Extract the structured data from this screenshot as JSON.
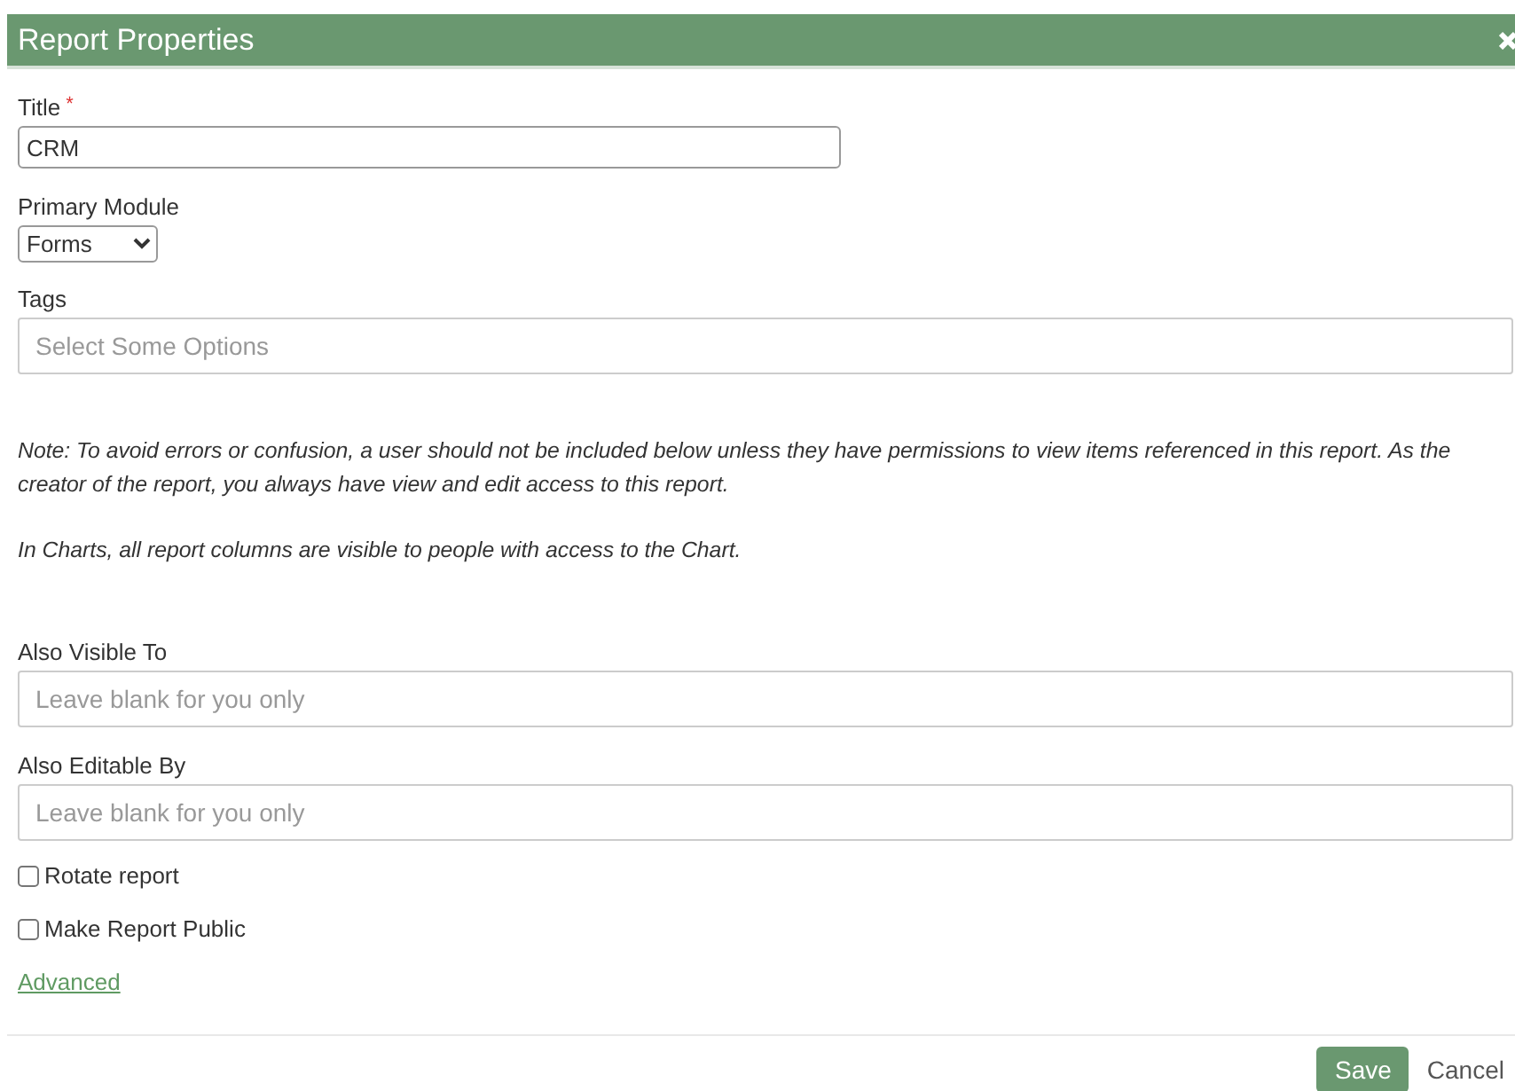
{
  "dialog": {
    "title": "Report Properties"
  },
  "title_field": {
    "label": "Title",
    "required_mark": "*",
    "value": "CRM"
  },
  "primary_module": {
    "label": "Primary Module",
    "value": "Forms"
  },
  "tags": {
    "label": "Tags",
    "placeholder": "Select Some Options"
  },
  "notes": [
    "Note: To avoid errors or confusion, a user should not be included below unless they have permissions to view items referenced in this report. As the creator of the report, you always have view and edit access to this report.",
    "In Charts, all report columns are visible to people with access to the Chart."
  ],
  "also_visible_to": {
    "label": "Also Visible To",
    "placeholder": "Leave blank for you only"
  },
  "also_editable_by": {
    "label": "Also Editable By",
    "placeholder": "Leave blank for you only"
  },
  "checkboxes": [
    {
      "label": "Rotate report",
      "checked": false
    },
    {
      "label": "Make Report Public",
      "checked": false
    }
  ],
  "advanced_link": "Advanced",
  "buttons": [
    {
      "label": "Save",
      "kind": "primary"
    },
    {
      "label": "Cancel",
      "kind": "link"
    }
  ]
}
